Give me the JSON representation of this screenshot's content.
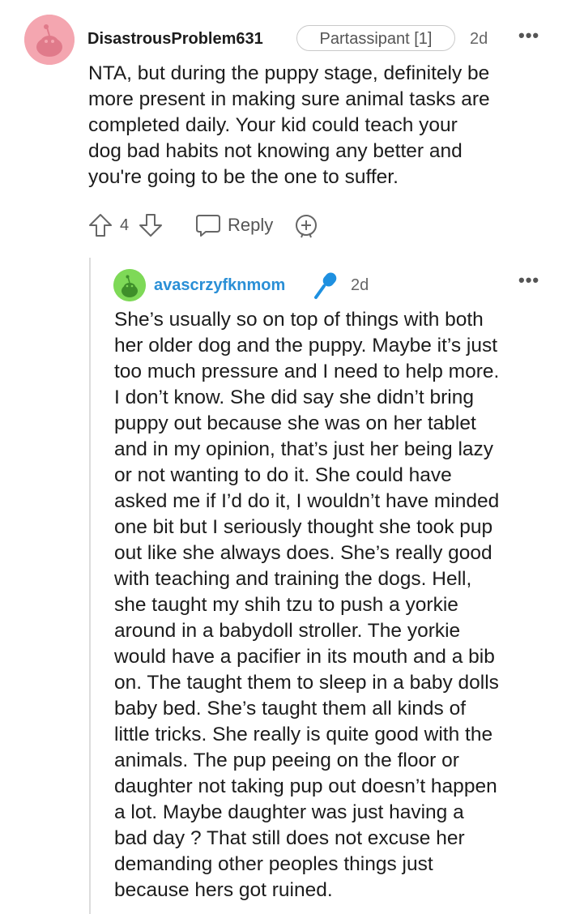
{
  "top_comment": {
    "username": "DisastrousProblem631",
    "flair": "Partassipant [1]",
    "time": "2d",
    "more_menu": "•••",
    "body": "NTA, but during the puppy stage, definitely be\nmore present in making sure animal tasks are\ncompleted daily. Your kid could teach your\ndog bad habits not knowing any better and\nyou're going to be the one to suffer.",
    "vote_count": "4",
    "reply_label": "Reply",
    "avatar_color": "#f4a6b0"
  },
  "reply_comment": {
    "username": "avascrzyfknmom",
    "time": "2d",
    "more_menu": "•••",
    "body": "She’s usually so on top of things with both\nher older dog and the puppy. Maybe it’s just\ntoo much pressure and I need to help more.\nI don’t know. She did say she didn’t bring\npuppy out because she was on her tablet\nand in my opinion, that’s just her being lazy\nor not wanting to do it. She could have\nasked me if I’d do it, I wouldn’t have minded\none bit but I seriously thought she took pup\nout like she always does. She’s really good\nwith teaching and training the dogs. Hell,\nshe taught my shih tzu to push a yorkie\naround in a babydoll stroller. The yorkie\nwould have a pacifier in its mouth and a bib\non. The taught them to sleep in a baby dolls\nbaby bed. She’s taught them all kinds of\nlittle tricks. She really is quite good with the\nanimals. The pup peeing on the floor or\ndaughter not taking pup out doesn’t happen\na lot. Maybe daughter was just having a\nbad day ? That still does not excuse her\ndemanding other peoples things just\nbecause hers got ruined.",
    "username_color": "#2a8fd6",
    "avatar_color": "#7ed957",
    "mic_icon_color": "#1e90e0"
  },
  "icons": {
    "upvote": "upvote-arrow-icon",
    "downvote": "downvote-arrow-icon",
    "reply": "speech-bubble-icon",
    "award": "add-award-icon",
    "mic": "microphone-icon"
  }
}
